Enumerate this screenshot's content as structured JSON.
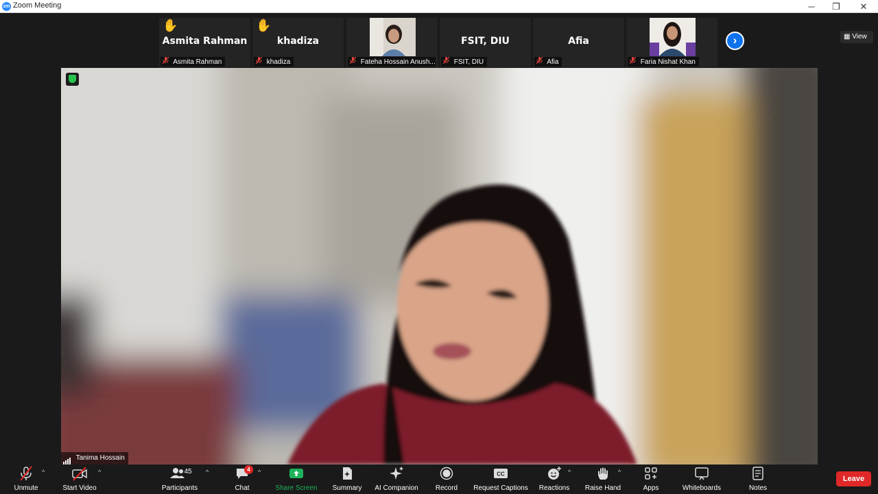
{
  "window": {
    "title": "Zoom Meeting",
    "logo_text": "zm",
    "minimize": "─",
    "restore": "❐",
    "close": "✕"
  },
  "view_button": {
    "icon": "▦",
    "label": "View"
  },
  "gallery": {
    "tiles": [
      {
        "big_name": "Asmita Rahman",
        "label": "Asmita Rahman",
        "hand_icon": "✋",
        "has_video": false
      },
      {
        "big_name": "khadiza",
        "label": "khadiza",
        "hand_icon": "✋",
        "has_video": false
      },
      {
        "big_name": "",
        "label": "Fateha Hossain Anush...",
        "has_video": true
      },
      {
        "big_name": "FSIT, DIU",
        "label": "FSIT, DIU",
        "has_video": false
      },
      {
        "big_name": "Afia",
        "label": "Afia",
        "has_video": false
      },
      {
        "big_name": "",
        "label": "Faria Nishat Khan",
        "has_video": true
      }
    ],
    "muted_icon": "muted-mic-icon",
    "next_icon": "›"
  },
  "main_video": {
    "speaker_name": "Tanima Hossain"
  },
  "toolbar": {
    "unmute": "Unmute",
    "start_video": "Start Video",
    "participants": "Participants",
    "participants_count": "45",
    "chat": "Chat",
    "chat_badge": "4",
    "share_screen": "Share Screen",
    "summary": "Summary",
    "ai_companion": "AI Companion",
    "record": "Record",
    "request_captions": "Request Captions",
    "captions_icon_text": "CC",
    "reactions": "Reactions",
    "raise_hand": "Raise Hand",
    "apps": "Apps",
    "whiteboards": "Whiteboards",
    "notes": "Notes",
    "leave": "Leave",
    "caret": "^"
  },
  "colors": {
    "accent_blue": "#0e72ed",
    "share_green": "#1fb25a",
    "leave_red": "#e02828",
    "muted_red": "#e0443e"
  }
}
